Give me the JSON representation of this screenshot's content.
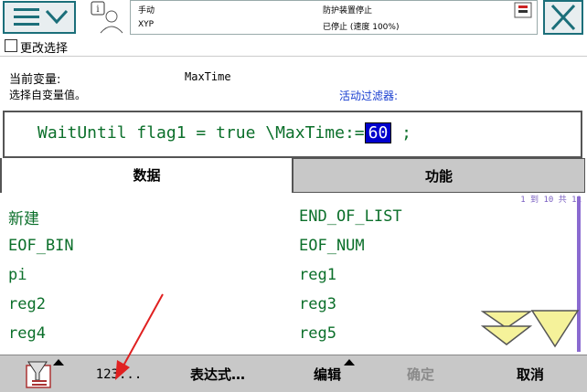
{
  "status": {
    "mode": "手动",
    "robot": "XYP",
    "safety": "防护装置停止",
    "state": "已停止 (速度 100%)"
  },
  "subtitle": "更改选择",
  "info": {
    "current_var_label": "当前变量:",
    "current_var_value": "MaxTime",
    "select_label": "选择自变量值。",
    "filter_label": "活动过滤器:"
  },
  "expression": {
    "prefix": "WaitUntil flag1 = true \\MaxTime:=",
    "value": "60",
    "suffix": ";"
  },
  "tabs": {
    "data": "数据",
    "function": "功能"
  },
  "page_indicator": "1 到 10 共 11",
  "list_items": [
    [
      "新建",
      "END_OF_LIST"
    ],
    [
      "EOF_BIN",
      "EOF_NUM"
    ],
    [
      "pi",
      "reg1"
    ],
    [
      "reg2",
      "reg3"
    ],
    [
      "reg4",
      "reg5"
    ]
  ],
  "toolbar": {
    "numpad": "123...",
    "expression": "表达式…",
    "edit": "编辑",
    "ok": "确定",
    "cancel": "取消"
  },
  "colors": {
    "accent": "#1b6f7a",
    "list_text": "#0b6f2a",
    "highlight": "#0000cc",
    "toolbar_bg": "#c8c8c8",
    "annotation": "#e02020"
  }
}
